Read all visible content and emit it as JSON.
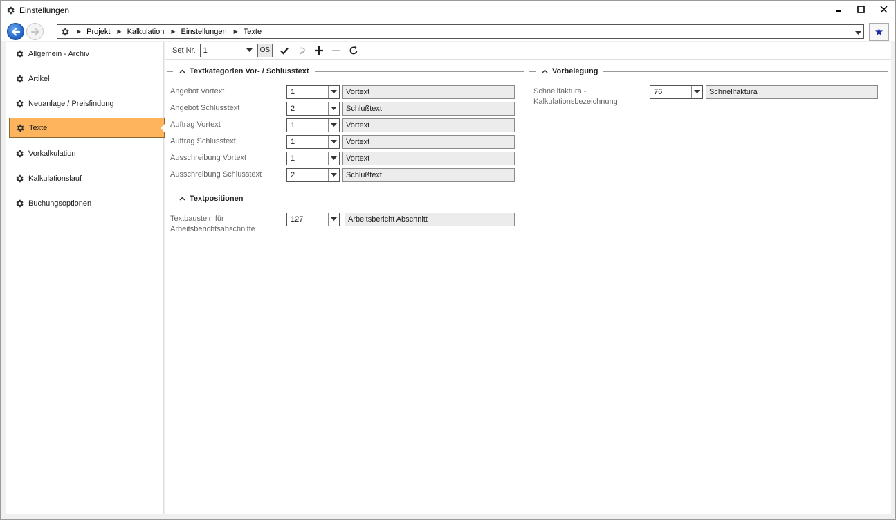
{
  "window": {
    "title": "Einstellungen",
    "minimize": "▁",
    "maximize": "☐",
    "close": "✕"
  },
  "address": {
    "crumbs": [
      "Projekt",
      "Kalkulation",
      "Einstellungen",
      "Texte"
    ]
  },
  "sidebar": {
    "items": [
      {
        "label": "Allgemein - Archiv",
        "active": false
      },
      {
        "label": "Artikel",
        "active": false
      },
      {
        "label": "Neuanlage / Preisfindung",
        "active": false
      },
      {
        "label": "Texte",
        "active": true
      },
      {
        "label": "Vorkalkulation",
        "active": false
      },
      {
        "label": "Kalkulationslauf",
        "active": false
      },
      {
        "label": "Buchungsoptionen",
        "active": false
      }
    ]
  },
  "toolbar": {
    "set_label": "Set Nr.",
    "set_value": "1",
    "os_label": "OS"
  },
  "sections": {
    "textkategorien": {
      "title": "Textkategorien Vor- / Schlusstext",
      "rows": [
        {
          "label": "Angebot Vortext",
          "value": "1",
          "desc": "Vortext"
        },
        {
          "label": "Angebot Schlusstext",
          "value": "2",
          "desc": "Schlußtext"
        },
        {
          "label": "Auftrag Vortext",
          "value": "1",
          "desc": "Vortext"
        },
        {
          "label": "Auftrag Schlusstext",
          "value": "1",
          "desc": "Vortext"
        },
        {
          "label": "Ausschreibung Vortext",
          "value": "1",
          "desc": "Vortext"
        },
        {
          "label": "Ausschreibung Schlusstext",
          "value": "2",
          "desc": "Schlußtext"
        }
      ]
    },
    "vorbelegung": {
      "title": "Vorbelegung",
      "rows": [
        {
          "label_line1": "Schnellfaktura -",
          "label_line2": "Kalkulationsbezeichnung",
          "value": "76",
          "desc": "Schnellfaktura"
        }
      ]
    },
    "textpositionen": {
      "title": "Textpositionen",
      "rows": [
        {
          "label_line1": "Textbaustein für",
          "label_line2": "Arbeitsberichtsabschnitte",
          "value": "127",
          "desc": "Arbeitsbericht Abschnitt"
        }
      ]
    }
  },
  "colors": {
    "accent": "#fdb45c",
    "nav_blue": "#1c5fc2",
    "star": "#1b2fa0"
  }
}
